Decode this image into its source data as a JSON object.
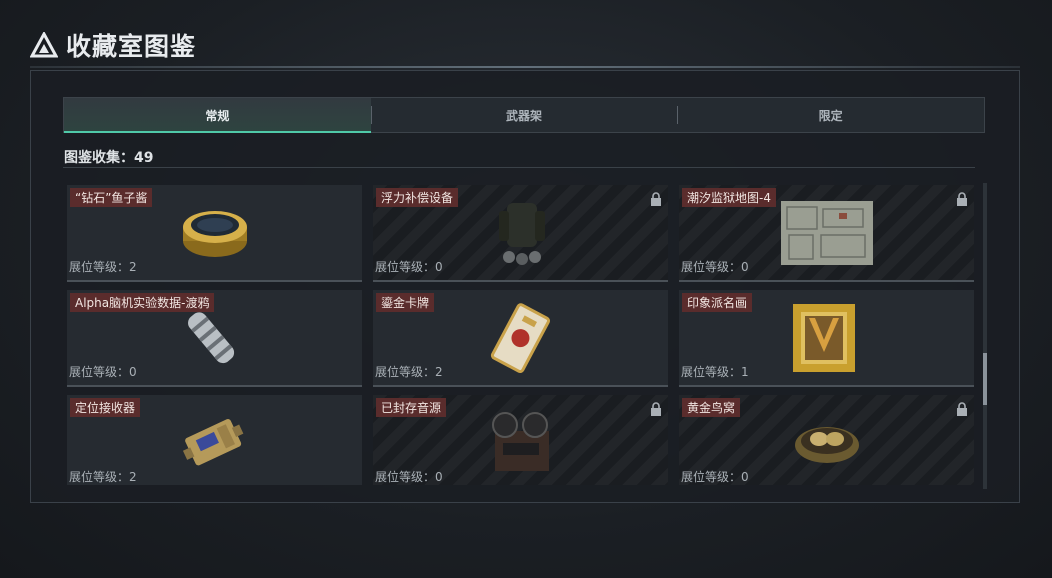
{
  "header": {
    "title": "收藏室图鉴",
    "logo_icon": "triangle-logo-icon"
  },
  "tabs": [
    {
      "label": "常规",
      "active": true
    },
    {
      "label": "武器架",
      "active": false
    },
    {
      "label": "限定",
      "active": false
    }
  ],
  "collection": {
    "count_label": "图鉴收集：49"
  },
  "items": [
    {
      "name": "“钻石”鱼子酱",
      "level": "展位等级：2",
      "locked": false,
      "icon": "caviar-tin-icon"
    },
    {
      "name": "浮力补偿设备",
      "level": "展位等级：0",
      "locked": true,
      "icon": "buoyancy-device-icon"
    },
    {
      "name": "潮汐监狱地图-4",
      "level": "展位等级：0",
      "locked": true,
      "icon": "prison-map-icon"
    },
    {
      "name": "Alpha脑机实验数据-渡鸦",
      "level": "展位等级：0",
      "locked": false,
      "icon": "data-canister-icon"
    },
    {
      "name": "鎏金卡牌",
      "level": "展位等级：2",
      "locked": false,
      "icon": "gilded-card-icon"
    },
    {
      "name": "印象派名画",
      "level": "展位等级：1",
      "locked": false,
      "icon": "framed-painting-icon"
    },
    {
      "name": "定位接收器",
      "level": "展位等级：2",
      "locked": false,
      "icon": "receiver-device-icon"
    },
    {
      "name": "已封存音源",
      "level": "展位等级：0",
      "locked": true,
      "icon": "reel-recorder-icon"
    },
    {
      "name": "黄金鸟窝",
      "level": "展位等级：0",
      "locked": true,
      "icon": "golden-nest-icon"
    }
  ],
  "colors": {
    "accent": "#4fc9a8",
    "name_tag": "#5a2c2c",
    "panel": "#1a1e23"
  }
}
